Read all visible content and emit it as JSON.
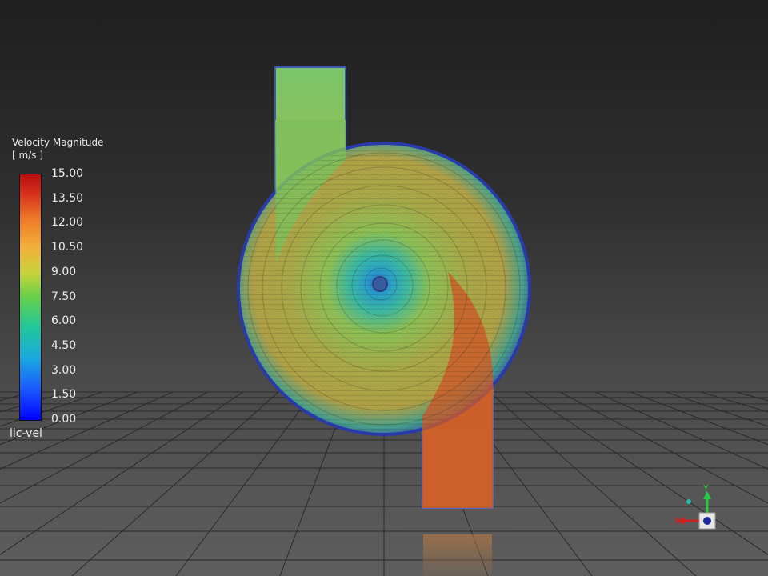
{
  "legend": {
    "title": "Velocity Magnitude",
    "unit": "[ m/s ]",
    "name": "lic-vel",
    "ticks": [
      "15.00",
      "13.50",
      "12.00",
      "10.50",
      "9.00",
      "7.50",
      "6.00",
      "4.50",
      "3.00",
      "1.50",
      "0.00"
    ]
  },
  "orientation_axes": {
    "x_label": "X",
    "y_label": "Y"
  },
  "colors": {
    "background_top": "#1f1f1f",
    "background_bottom": "#5e5e5e",
    "grid_line": "#2a2a2a",
    "axis_x": "#cc2222",
    "axis_y": "#22cc44",
    "axis_z": "#2244cc"
  }
}
